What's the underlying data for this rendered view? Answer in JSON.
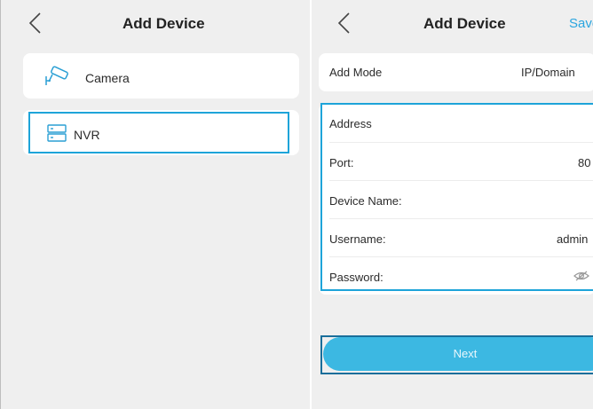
{
  "left_screen": {
    "title": "Add Device",
    "items": [
      {
        "label": "Camera",
        "icon": "cctv-camera-icon"
      },
      {
        "label": "NVR",
        "icon": "nvr-recorder-icon"
      }
    ]
  },
  "right_screen": {
    "title": "Add Device",
    "save_label": "Save",
    "add_mode": {
      "label": "Add Mode",
      "value": "IP/Domain"
    },
    "fields": [
      {
        "label": "Address",
        "value": ""
      },
      {
        "label": "Port:",
        "value": "80"
      },
      {
        "label": "Device Name:",
        "value": ""
      },
      {
        "label": "Username:",
        "value": "admin"
      },
      {
        "label": "Password:",
        "value": ""
      }
    ],
    "next_label": "Next"
  },
  "colors": {
    "accent": "#3cb8e2",
    "highlight": "#1ea4d9",
    "save": "#2aa5df"
  }
}
